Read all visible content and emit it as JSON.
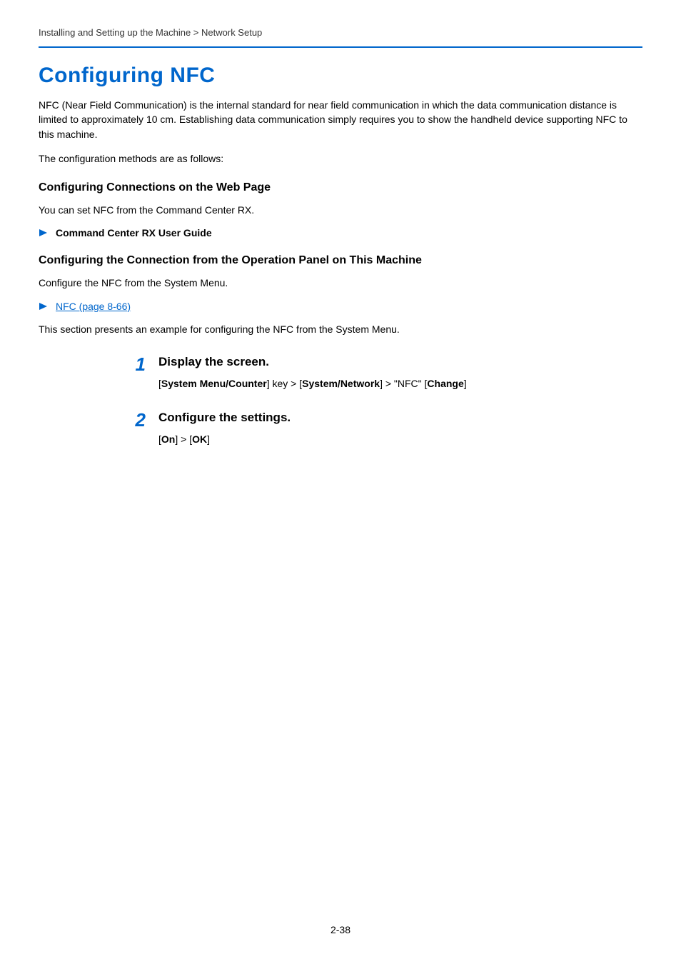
{
  "breadcrumb": "Installing and Setting up the Machine > Network Setup",
  "title": "Configuring NFC",
  "intro1": "NFC (Near Field Communication) is the internal standard for near field communication in which the data communication distance is limited to approximately 10 cm. Establishing data communication simply requires you to show the handheld device supporting NFC to this machine.",
  "intro2": "The configuration methods are as follows:",
  "section1": {
    "title": "Configuring Connections on the Web Page",
    "body": "You can set NFC from the Command Center RX.",
    "ref": "Command Center RX User Guide"
  },
  "section2": {
    "title": "Configuring the Connection from the Operation Panel on This Machine",
    "body": "Configure the NFC from the System Menu.",
    "link": "NFC (page 8-66)",
    "afterlink": "This section presents an example for configuring the NFC from the System Menu."
  },
  "steps": [
    {
      "num": "1",
      "title": "Display the screen.",
      "parts": {
        "p1": "[",
        "p2": "System Menu/Counter",
        "p3": "] key > [",
        "p4": "System/Network",
        "p5": "] > \"NFC\" [",
        "p6": "Change",
        "p7": "]"
      }
    },
    {
      "num": "2",
      "title": "Configure the settings.",
      "parts": {
        "p1": "[",
        "p2": "On",
        "p3": "] > [",
        "p4": "OK",
        "p5": "]",
        "p6": "",
        "p7": ""
      }
    }
  ],
  "pagenum": "2-38"
}
